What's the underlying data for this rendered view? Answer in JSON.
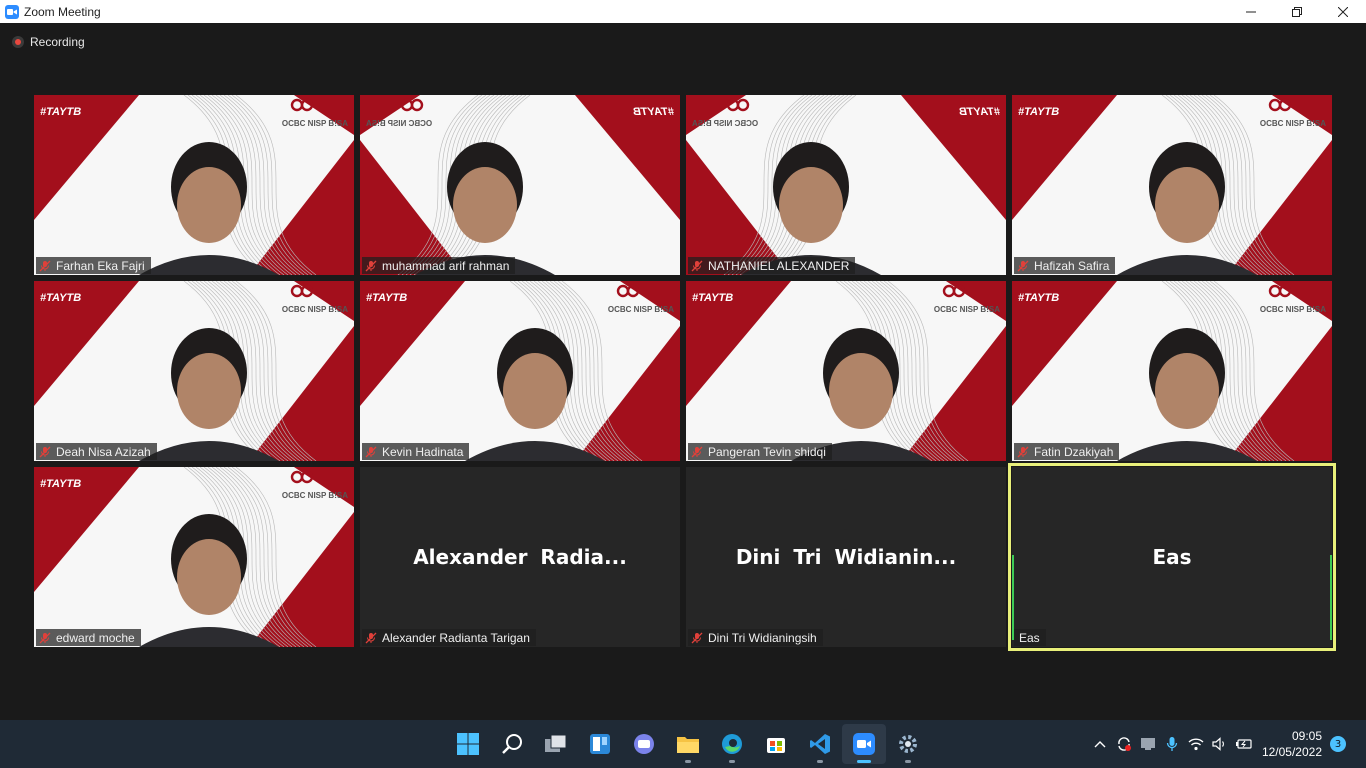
{
  "window": {
    "title": "Zoom Meeting"
  },
  "recording": {
    "label": "Recording"
  },
  "background_text": {
    "brand": "OCBC NISP B!SA",
    "tag": "#TAYTB",
    "tag_mirrored": "#TAYTB"
  },
  "participants": [
    {
      "name": "Farhan Eka Fajri",
      "video": true,
      "muted": true
    },
    {
      "name": "muhammad arif rahman",
      "video": true,
      "muted": true,
      "mirrored": true
    },
    {
      "name": "NATHANIEL ALEXANDER",
      "video": true,
      "muted": true,
      "mirrored": true
    },
    {
      "name": "Hafizah Safira",
      "video": true,
      "muted": true
    },
    {
      "name": "Deah Nisa Azizah",
      "video": true,
      "muted": true
    },
    {
      "name": "Kevin Hadinata",
      "video": true,
      "muted": true
    },
    {
      "name": "Pangeran Tevin shidqi",
      "video": true,
      "muted": true
    },
    {
      "name": "Fatin Dzakiyah",
      "video": true,
      "muted": true
    },
    {
      "name": "edward moche",
      "video": true,
      "muted": true
    },
    {
      "name": "Alexander Radianta Tarigan",
      "display": "Alexander  Radia...",
      "video": false,
      "muted": true
    },
    {
      "name": "Dini Tri Widianingsih",
      "display": "Dini  Tri  Widianin...",
      "video": false,
      "muted": true
    },
    {
      "name": "Eas",
      "display": "Eas",
      "video": false,
      "muted": false,
      "active_speaker": true
    }
  ],
  "taskbar": {
    "apps": [
      "windows-start-icon",
      "search-icon",
      "task-view-icon",
      "widgets-icon",
      "teams-chat-icon",
      "file-explorer-icon",
      "edge-icon",
      "store-icon",
      "vscode-icon",
      "zoom-icon",
      "settings-icon"
    ],
    "selected_app": "zoom-icon"
  },
  "tray": {
    "time": "09:05",
    "date": "12/05/2022",
    "notifications": "3"
  },
  "colors": {
    "brand_red": "#a30f1c",
    "active_border": "#e9f07a",
    "taskbar": "#1f2a36"
  }
}
